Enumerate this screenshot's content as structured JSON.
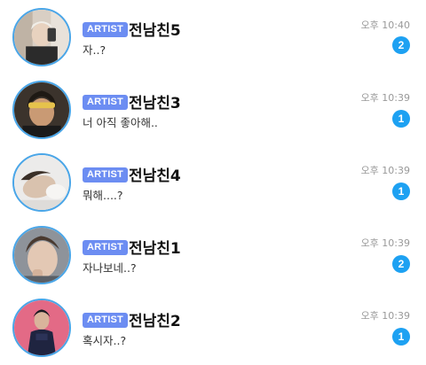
{
  "chats": [
    {
      "badge": "ARTIST",
      "name": "전남친5",
      "preview": "자..?",
      "time": "오후 10:40",
      "unread": "2",
      "avatar": "selfie-avatar"
    },
    {
      "badge": "ARTIST",
      "name": "전남친3",
      "preview": "너 아직 좋아해..",
      "time": "오후 10:39",
      "unread": "1",
      "avatar": "headband-avatar"
    },
    {
      "badge": "ARTIST",
      "name": "전남친4",
      "preview": "뭐해....?",
      "time": "오후 10:39",
      "unread": "1",
      "avatar": "lying-down-avatar"
    },
    {
      "badge": "ARTIST",
      "name": "전남친1",
      "preview": "자나보네..?",
      "time": "오후 10:39",
      "unread": "2",
      "avatar": "closeup-avatar"
    },
    {
      "badge": "ARTIST",
      "name": "전남친2",
      "preview": "혹시자..?",
      "time": "오후 10:39",
      "unread": "1",
      "avatar": "pink-background-avatar"
    }
  ],
  "colors": {
    "artist_badge": "#6c8df2",
    "unread_badge": "#1da1f2",
    "avatar_ring": "#4aa6e8",
    "time_text": "#999999"
  }
}
